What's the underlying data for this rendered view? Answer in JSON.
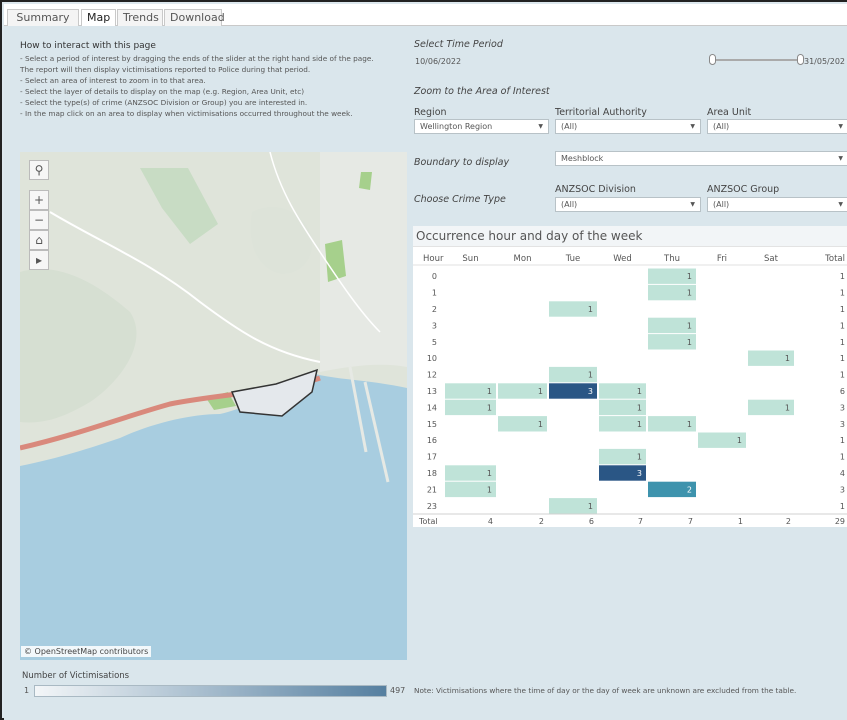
{
  "tabs": [
    "Summary",
    "Map",
    "Trends",
    "Download"
  ],
  "active_tab": "Map",
  "instructions": {
    "title": "How to interact with this page",
    "lines": [
      "- Select a period of interest by dragging the ends of the slider at the right hand side of the page.",
      "The report will then display victimisations reported to Police during that period.",
      "- Select an area of interest to zoom in to that area.",
      "- Select the layer of details to display on the map (e.g. Region, Area Unit, etc)",
      "- Select the type(s) of crime (ANZSOC Division or Group) you are interested in.",
      "- In the map click on an area to display when victimisations occurred throughout the week."
    ]
  },
  "time_period": {
    "label": "Select Time Period",
    "start": "10/06/2022",
    "end": "31/05/202"
  },
  "zoom_label": "Zoom to the Area of Interest",
  "filters": {
    "region": {
      "label": "Region",
      "value": "Wellington Region"
    },
    "ta": {
      "label": "Territorial Authority",
      "value": "(All)"
    },
    "area_unit": {
      "label": "Area Unit",
      "value": "(All)"
    },
    "boundary": {
      "label": "Boundary to display",
      "value": "Meshblock"
    },
    "crime_type_label": "Choose Crime Type",
    "division": {
      "label": "ANZSOC Division",
      "value": "(All)"
    },
    "group": {
      "label": "ANZSOC Group",
      "value": "(All)"
    }
  },
  "map": {
    "attribution": "© OpenStreetMap contributors",
    "controls": [
      "search-icon",
      "zoom-in-icon",
      "zoom-out-icon",
      "home-icon",
      "expand-arrow-icon"
    ],
    "water_color": "#a8cde0",
    "land_color": "#dfe4da",
    "park_color": "#c8dcc4",
    "selected_area_color": "#e4e8ec"
  },
  "legend": {
    "title": "Number of Victimisations",
    "min": "1",
    "max": "497",
    "color_low": "#f3f6f8",
    "color_high": "#557fa0"
  },
  "chart_data": {
    "type": "heatmap",
    "title": "Occurrence hour and day of the week",
    "row_header": "Hour",
    "columns": [
      "Sun",
      "Mon",
      "Tue",
      "Wed",
      "Thu",
      "Fri",
      "Sat"
    ],
    "total_label": "Total",
    "rows": [
      {
        "hour": "0",
        "values": [
          null,
          null,
          null,
          null,
          1,
          null,
          null
        ],
        "total": 1
      },
      {
        "hour": "1",
        "values": [
          null,
          null,
          null,
          null,
          1,
          null,
          null
        ],
        "total": 1
      },
      {
        "hour": "2",
        "values": [
          null,
          null,
          1,
          null,
          null,
          null,
          null
        ],
        "total": 1
      },
      {
        "hour": "3",
        "values": [
          null,
          null,
          null,
          null,
          1,
          null,
          null
        ],
        "total": 1
      },
      {
        "hour": "5",
        "values": [
          null,
          null,
          null,
          null,
          1,
          null,
          null
        ],
        "total": 1
      },
      {
        "hour": "10",
        "values": [
          null,
          null,
          null,
          null,
          null,
          null,
          1
        ],
        "total": 1
      },
      {
        "hour": "12",
        "values": [
          null,
          null,
          1,
          null,
          null,
          null,
          null
        ],
        "total": 1
      },
      {
        "hour": "13",
        "values": [
          1,
          1,
          3,
          1,
          null,
          null,
          null
        ],
        "total": 6
      },
      {
        "hour": "14",
        "values": [
          1,
          null,
          null,
          1,
          null,
          null,
          1
        ],
        "total": 3
      },
      {
        "hour": "15",
        "values": [
          null,
          1,
          null,
          1,
          1,
          null,
          null
        ],
        "total": 3
      },
      {
        "hour": "16",
        "values": [
          null,
          null,
          null,
          null,
          null,
          1,
          null
        ],
        "total": 1
      },
      {
        "hour": "17",
        "values": [
          null,
          null,
          null,
          1,
          null,
          null,
          null
        ],
        "total": 1
      },
      {
        "hour": "18",
        "values": [
          1,
          null,
          null,
          3,
          null,
          null,
          null
        ],
        "total": 4
      },
      {
        "hour": "21",
        "values": [
          1,
          null,
          null,
          null,
          2,
          null,
          null
        ],
        "total": 3
      },
      {
        "hour": "23",
        "values": [
          null,
          null,
          1,
          null,
          null,
          null,
          null
        ],
        "total": 1
      }
    ],
    "column_totals": [
      4,
      2,
      6,
      7,
      7,
      1,
      2
    ],
    "grand_total": 29,
    "colors": {
      "1": "#bfe3d8",
      "2": "#3e93ad",
      "3": "#2a5685"
    }
  },
  "note": "Note: Victimisations where the time of day or the day of week are unknown are excluded from the table."
}
